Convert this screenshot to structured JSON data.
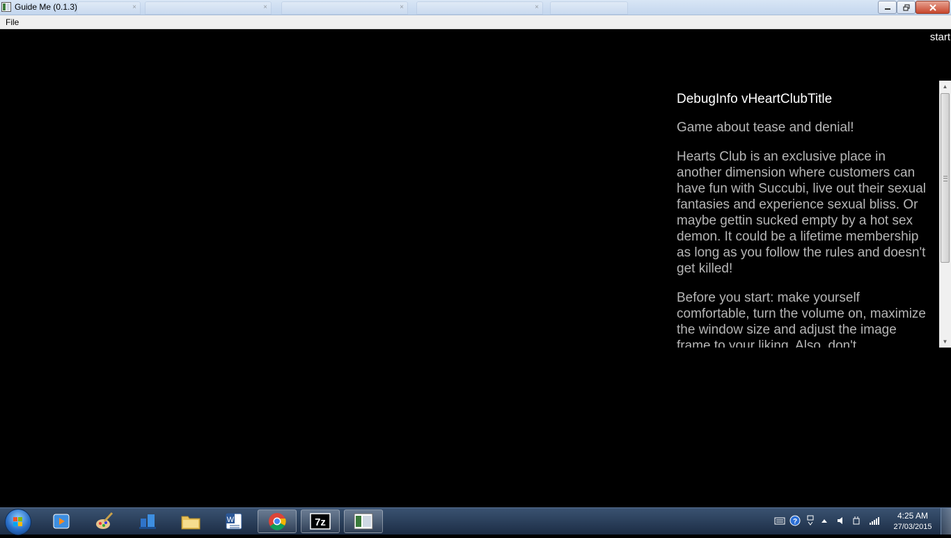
{
  "window": {
    "title": "Guide Me (0.1.3)",
    "minimize_icon": "minimize-icon",
    "maximize_icon": "restore-icon",
    "close_icon": "close-icon"
  },
  "menu": {
    "file": "File"
  },
  "main": {
    "start_label": "start",
    "debug_title": "DebugInfo vHeartClubTitle",
    "paragraphs": [
      "Game about tease and denial!",
      "Hearts Club is an exclusive place in another dimension where customers can have fun with Succubi, live out their sexual fantasies and experience sexual bliss. Or maybe gettin sucked empty by a hot sex demon. It could be a lifetime membership as long as you follow the rules and doesn't get killed!",
      "Before you start: make yourself comfortable, turn the volume on, maximize the window size and adjust the image frame to your liking. Also, don't"
    ]
  },
  "taskbar": {
    "apps": [
      {
        "icon": "media-player-icon"
      },
      {
        "icon": "paint-icon"
      },
      {
        "icon": "network-icon"
      },
      {
        "icon": "folder-icon"
      },
      {
        "icon": "word-icon",
        "label": "W"
      },
      {
        "icon": "chrome-icon"
      },
      {
        "icon": "7zip-icon",
        "label": "7z"
      },
      {
        "icon": "guide-me-icon"
      }
    ],
    "clock_time": "4:25 AM",
    "clock_date": "27/03/2015"
  },
  "colors": {
    "background": "#000000",
    "title_text": "#ffffff",
    "body_text": "#b5b5b5",
    "taskbar": "#1c2d45"
  }
}
